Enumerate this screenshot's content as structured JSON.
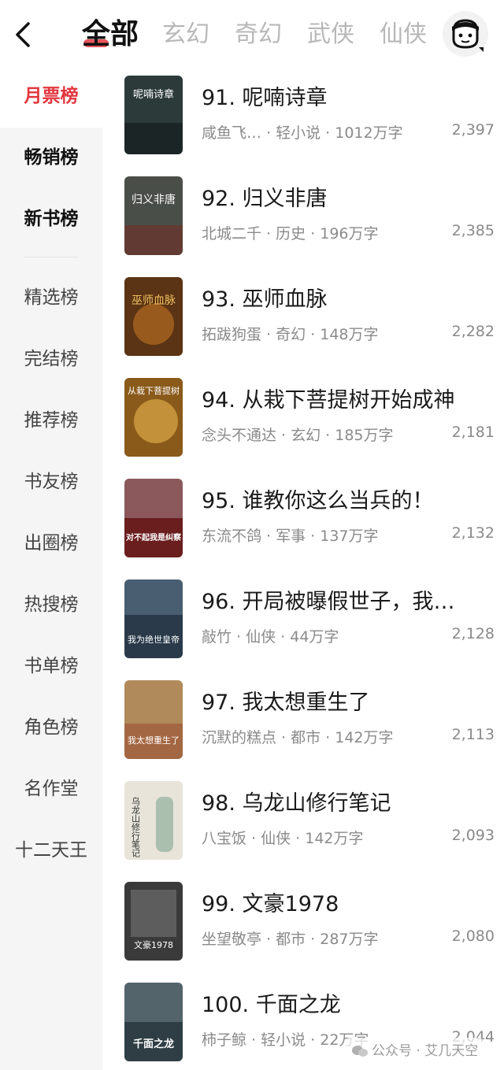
{
  "header": {
    "tabs": [
      {
        "label": "全部",
        "active": true
      },
      {
        "label": "玄幻",
        "active": false
      },
      {
        "label": "奇幻",
        "active": false
      },
      {
        "label": "武侠",
        "active": false
      },
      {
        "label": "仙侠",
        "active": false
      }
    ],
    "back_icon": "chevron-left-icon",
    "avatar_icon": "user-avatar-icon"
  },
  "sidebar": {
    "items": [
      {
        "label": "月票榜",
        "state": "active"
      },
      {
        "label": "畅销榜",
        "state": "bold"
      },
      {
        "label": "新书榜",
        "state": "bold"
      },
      {
        "label": "精选榜",
        "state": "normal"
      },
      {
        "label": "完结榜",
        "state": "normal"
      },
      {
        "label": "推荐榜",
        "state": "normal"
      },
      {
        "label": "书友榜",
        "state": "normal"
      },
      {
        "label": "出圈榜",
        "state": "normal"
      },
      {
        "label": "热搜榜",
        "state": "normal"
      },
      {
        "label": "书单榜",
        "state": "normal"
      },
      {
        "label": "角色榜",
        "state": "normal"
      },
      {
        "label": "名作堂",
        "state": "normal"
      },
      {
        "label": "十二天王",
        "state": "normal"
      }
    ]
  },
  "books": [
    {
      "rank": "91.",
      "title": "呢喃诗章",
      "meta": "咸鱼飞… · 轻小说 · 1012万字",
      "votes": "2,397",
      "cover_text": "呢喃诗章",
      "cover_color": "#2c3a3a"
    },
    {
      "rank": "92.",
      "title": "归义非唐",
      "meta": "北城二千 · 历史 · 196万字",
      "votes": "2,385",
      "cover_text": "归义非唐",
      "cover_color": "#4a4e48"
    },
    {
      "rank": "93.",
      "title": "巫师血脉",
      "meta": "拓跋狗蛋 · 奇幻 · 148万字",
      "votes": "2,282",
      "cover_text": "巫师血脉",
      "cover_color": "#5a3414"
    },
    {
      "rank": "94.",
      "title": "从栽下菩提树开始成神",
      "meta": "念头不通达 · 玄幻 · 185万字",
      "votes": "2,181",
      "cover_text": "从栽下菩提树",
      "cover_color": "#8a5a1a"
    },
    {
      "rank": "95.",
      "title": "谁教你这么当兵的！",
      "meta": "东流不鸽 · 军事 · 137万字",
      "votes": "2,132",
      "cover_text": "对不起我是纠察",
      "cover_color": "#6a1e1e"
    },
    {
      "rank": "96.",
      "title": "开局被曝假世子，我…",
      "meta": "敲竹 · 仙侠 · 44万字",
      "votes": "2,128",
      "cover_text": "我为绝世皇帝",
      "cover_color": "#2a3a4a"
    },
    {
      "rank": "97.",
      "title": "我太想重生了",
      "meta": "沉默的糕点 · 都市 · 142万字",
      "votes": "2,113",
      "cover_text": "我太想重生了",
      "cover_color": "#b08a5a"
    },
    {
      "rank": "98.",
      "title": "乌龙山修行笔记",
      "meta": "八宝饭 · 仙侠 · 142万字",
      "votes": "2,093",
      "cover_text": "乌龙山修行笔记",
      "cover_color": "#e8e4da"
    },
    {
      "rank": "99.",
      "title": "文豪1978",
      "meta": "坐望敬亭 · 都市 · 287万字",
      "votes": "2,080",
      "cover_text": "文豪1978",
      "cover_color": "#3a3a3a"
    },
    {
      "rank": "100.",
      "title": "千面之龙",
      "meta": "柿子鲸 · 轻小说 · 22万字",
      "votes": "2,044",
      "cover_text": "千面之龙",
      "cover_color": "#2e3e44"
    }
  ],
  "watermark": {
    "text": "公众号 · 艾几天空"
  },
  "colors": {
    "accent": "#e2363f",
    "sidebar_bg": "#f5f5f5",
    "muted_text": "#8a8a8a"
  }
}
